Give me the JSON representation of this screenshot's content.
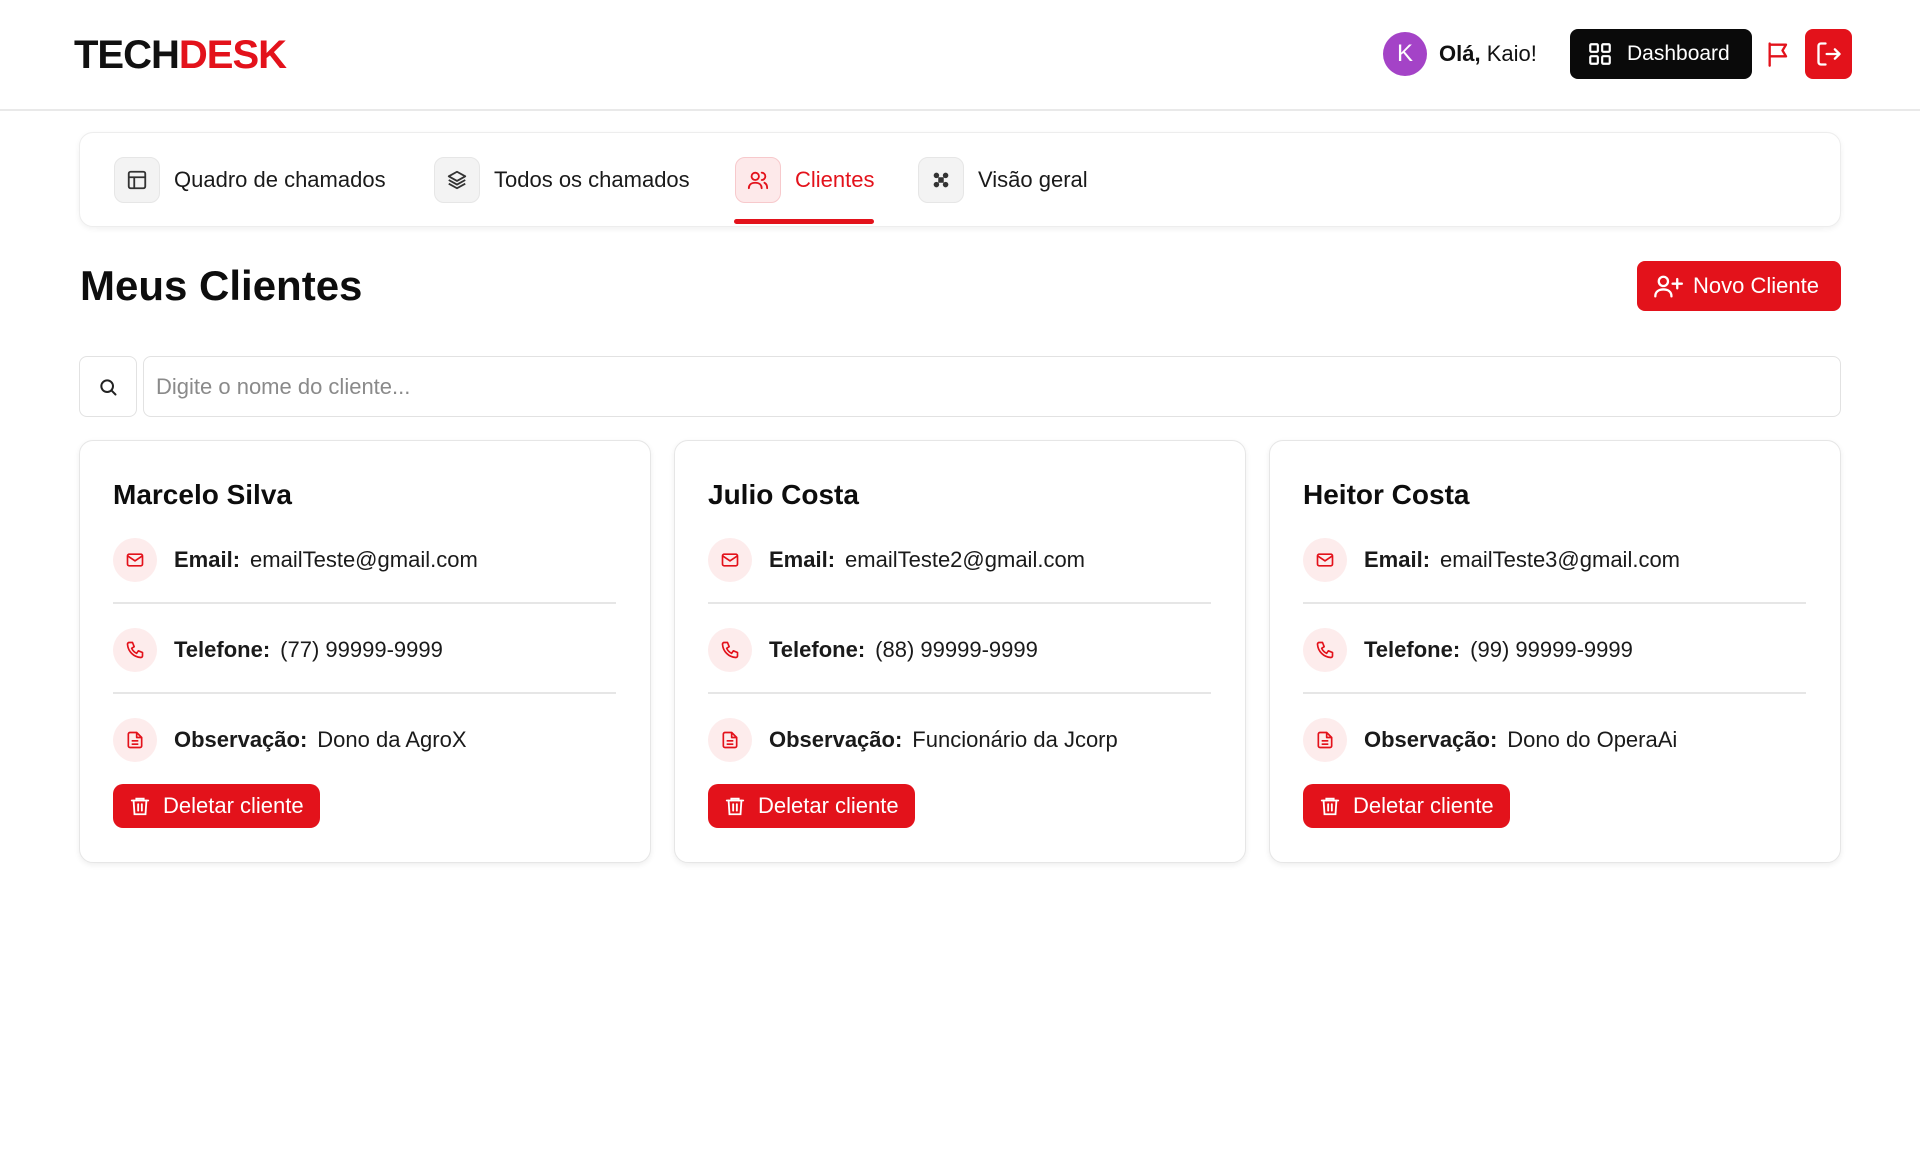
{
  "header": {
    "logo_part1": "TECH",
    "logo_part2": "DESK",
    "avatar_initial": "K",
    "greeting_bold": "Olá,",
    "greeting_name": " Kaio!",
    "dashboard_label": "Dashboard",
    "icons": {
      "dashboard": "grid-icon",
      "flag": "flag-icon",
      "logout": "logout-icon"
    }
  },
  "tabs": [
    {
      "label": "Quadro de chamados",
      "icon": "layout-icon",
      "active": false
    },
    {
      "label": "Todos os chamados",
      "icon": "layers-icon",
      "active": false
    },
    {
      "label": "Clientes",
      "icon": "users-icon",
      "active": true
    },
    {
      "label": "Visão geral",
      "icon": "grid-dots-icon",
      "active": false
    }
  ],
  "page": {
    "title": "Meus Clientes",
    "new_client_label": "Novo Cliente"
  },
  "search": {
    "placeholder": "Digite o nome do cliente...",
    "value": ""
  },
  "labels": {
    "email": "Email:",
    "phone": "Telefone:",
    "note": "Observação:",
    "delete": "Deletar cliente"
  },
  "clients": [
    {
      "name": "Marcelo Silva",
      "email": "emailTeste@gmail.com",
      "phone": "(77) 99999-9999",
      "note": "Dono da AgroX"
    },
    {
      "name": "Julio Costa",
      "email": "emailTeste2@gmail.com",
      "phone": "(88) 99999-9999",
      "note": "Funcionário da Jcorp"
    },
    {
      "name": "Heitor Costa",
      "email": "emailTeste3@gmail.com",
      "phone": "(99) 99999-9999",
      "note": "Dono do OperaAi"
    }
  ],
  "colors": {
    "accent": "#e3121b",
    "dark": "#0a0a0a",
    "avatar": "#a443c7"
  }
}
